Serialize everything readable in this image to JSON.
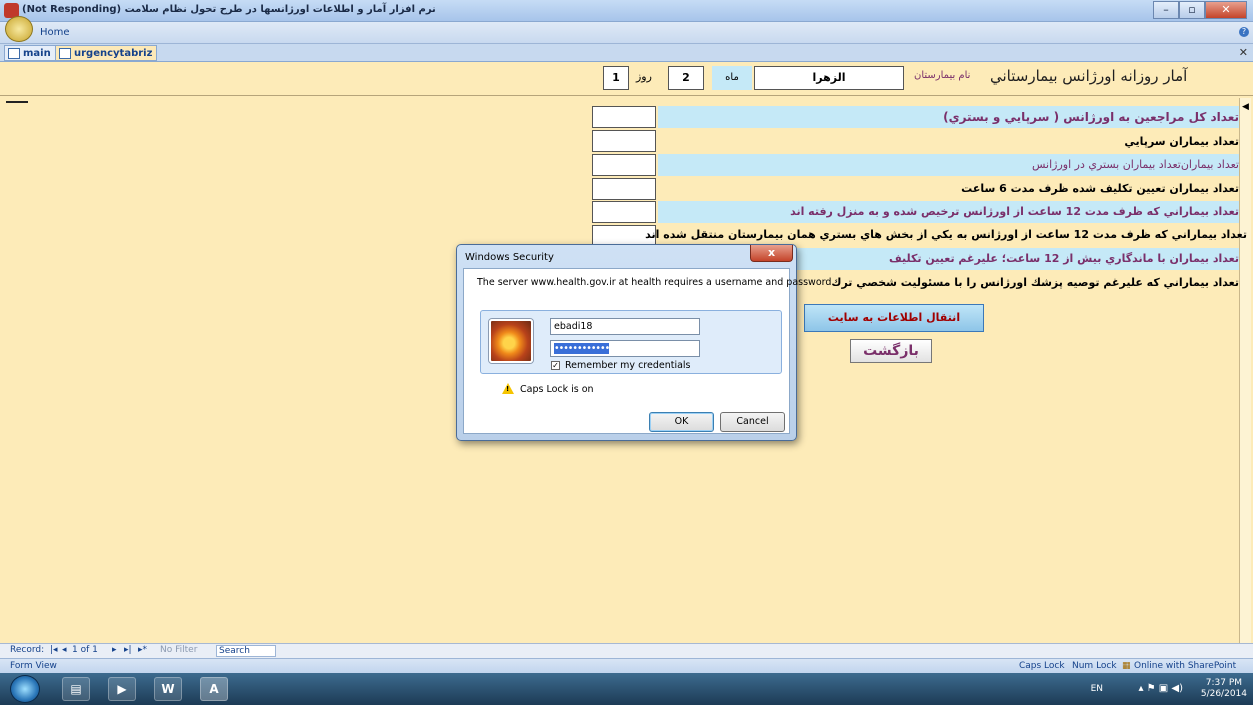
{
  "window": {
    "title": "(Not Responding) نرم افزار آمار و اطلاعات اورژانسها در طرح تحول نظام سلامت",
    "ribbon_tab": "Home"
  },
  "doc_tabs": [
    {
      "label": "main"
    },
    {
      "label": "urgencytabriz"
    }
  ],
  "header": {
    "title": "آمار روزانه اورژانس بيمارستاني",
    "hospital_label": "نام بيمارستان",
    "hospital_value": "الزهرا",
    "month_label": "ماه",
    "month_value": "2",
    "day_label": "روز",
    "day_value": "1"
  },
  "rows": [
    {
      "label": "تعداد كل مراجعين به اورژانس   ( سرپايي و بستري)",
      "value": ""
    },
    {
      "label": "تعداد بيماران سرپايي",
      "value": ""
    },
    {
      "label": "تعداد بيماران‌تعداد بيماران بستري در اورژانس",
      "value": ""
    },
    {
      "label": "تعداد بيماران تعيين تكليف شده ظرف مدت 6 ساعت",
      "value": ""
    },
    {
      "label": "تعداد بيماراني كه ظرف مدت 12 ساعت از اورژانس ترخيص شده و به منزل رفته اند",
      "value": ""
    },
    {
      "label": "تعداد بيماراني كه ظرف مدت 12 ساعت از اورژانس  به يكي از بخش هاي بستري همان بيمارستان منتقل شده اند",
      "value": ""
    },
    {
      "label": "تعداد بيماران با ماندگاري بيش از 12 ساعت؛ عليرغم تعيين تكليف",
      "value": ""
    },
    {
      "label": "تعداد بيماراني كه عليرغم توصيه پزشك اورژانس را با مسئوليت شخصي ترك",
      "value": ""
    }
  ],
  "buttons": {
    "send": "انتقال اطلاعات به سايت",
    "back": "بازگشت"
  },
  "dialog": {
    "title": "Windows Security",
    "close": "x",
    "message": "The server www.health.gov.ir at health requires a username and password.",
    "username": "ebadi18",
    "password_mask": "••••••••••••",
    "remember_label": "Remember my credentials",
    "remember_checked": true,
    "caps_warning": "Caps Lock is on",
    "ok": "OK",
    "cancel": "Cancel"
  },
  "record_nav": {
    "record_label": "Record:",
    "position": "1 of 1",
    "filter": "No Filter",
    "search": "Search"
  },
  "status": {
    "view": "Form View",
    "caps": "Caps Lock",
    "num": "Num Lock",
    "online": "Online with SharePoint"
  },
  "taskbar": {
    "lang": "EN",
    "time": "7:37 PM",
    "date": "5/26/2014"
  }
}
